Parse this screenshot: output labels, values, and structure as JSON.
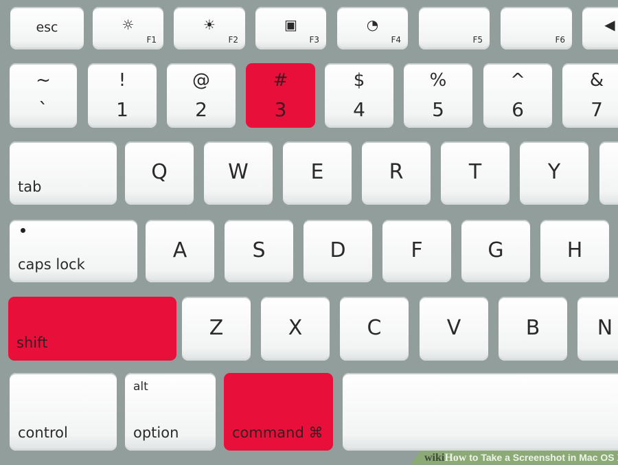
{
  "colors": {
    "background": "#919e9c",
    "key": "#ffffff",
    "highlight": "#e8103a"
  },
  "keys": [
    {
      "type": "esc",
      "label": "esc"
    },
    {
      "type": "fn",
      "icon": "brightness-down-icon",
      "glyph": "☼",
      "fn": "F1"
    },
    {
      "type": "fn",
      "icon": "brightness-up-icon",
      "glyph": "☀",
      "fn": "F2"
    },
    {
      "type": "fn",
      "icon": "mission-control-icon",
      "glyph": "▣",
      "fn": "F3"
    },
    {
      "type": "fn",
      "icon": "dashboard-icon",
      "glyph": "◔",
      "fn": "F4"
    },
    {
      "type": "fn",
      "icon": "",
      "glyph": "",
      "fn": "F5"
    },
    {
      "type": "fn",
      "icon": "",
      "glyph": "",
      "fn": "F6"
    },
    {
      "type": "fn",
      "icon": "rewind-icon",
      "glyph": "◀",
      "fn": ""
    },
    {
      "type": "dual",
      "top": "~",
      "bottom": "`"
    },
    {
      "type": "dual",
      "top": "!",
      "bottom": "1"
    },
    {
      "type": "dual",
      "top": "@",
      "bottom": "2"
    },
    {
      "type": "dual",
      "top": "#",
      "bottom": "3",
      "highlighted": true
    },
    {
      "type": "dual",
      "top": "$",
      "bottom": "4"
    },
    {
      "type": "dual",
      "top": "%",
      "bottom": "5"
    },
    {
      "type": "dual",
      "top": "^",
      "bottom": "6"
    },
    {
      "type": "dual",
      "top": "&",
      "bottom": "7"
    },
    {
      "type": "mod",
      "label": "tab"
    },
    {
      "type": "char",
      "label": "Q"
    },
    {
      "type": "char",
      "label": "W"
    },
    {
      "type": "char",
      "label": "E"
    },
    {
      "type": "char",
      "label": "R"
    },
    {
      "type": "char",
      "label": "T"
    },
    {
      "type": "char",
      "label": "Y"
    },
    {
      "type": "char",
      "label": ""
    },
    {
      "type": "mod",
      "label": "caps lock",
      "dot": true
    },
    {
      "type": "char",
      "label": "A"
    },
    {
      "type": "char",
      "label": "S"
    },
    {
      "type": "char",
      "label": "D"
    },
    {
      "type": "char",
      "label": "F"
    },
    {
      "type": "char",
      "label": "G"
    },
    {
      "type": "char",
      "label": "H"
    },
    {
      "type": "mod",
      "label": "shift",
      "highlighted": true
    },
    {
      "type": "char",
      "label": "Z"
    },
    {
      "type": "char",
      "label": "X"
    },
    {
      "type": "char",
      "label": "C"
    },
    {
      "type": "char",
      "label": "V"
    },
    {
      "type": "char",
      "label": "B"
    },
    {
      "type": "char",
      "label": "N"
    },
    {
      "type": "mod",
      "label": "control"
    },
    {
      "type": "mod",
      "label": "option",
      "alt": "alt"
    },
    {
      "type": "mod",
      "label": "command ⌘",
      "highlighted": true
    },
    {
      "type": "mod",
      "label": ""
    }
  ],
  "banner": {
    "brand_wiki": "wiki",
    "brand_how": "How",
    "title": " to Take a Screenshot in Mac OS X"
  }
}
